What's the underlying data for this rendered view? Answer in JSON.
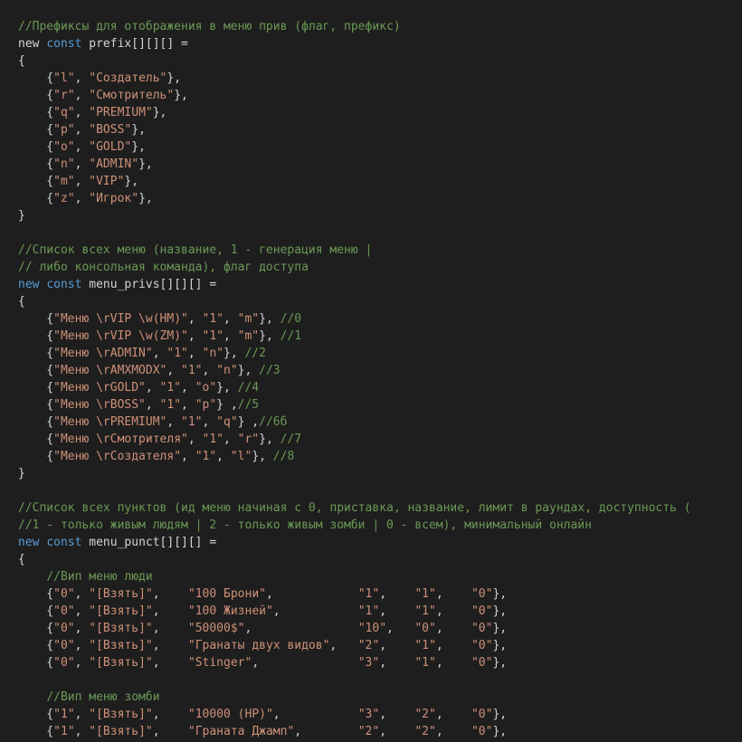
{
  "code": {
    "lines": [
      [
        {
          "t": "comment",
          "v": "//Префиксы для отображения в меню прив (флаг, префикс)"
        }
      ],
      [
        {
          "t": "plain",
          "v": "new "
        },
        {
          "t": "keyword",
          "v": "const"
        },
        {
          "t": "plain",
          "v": " prefix[][][] ="
        }
      ],
      [
        {
          "t": "plain",
          "v": "{"
        }
      ],
      [
        {
          "t": "plain",
          "v": "    {"
        },
        {
          "t": "string",
          "v": "\"l\""
        },
        {
          "t": "plain",
          "v": ", "
        },
        {
          "t": "string",
          "v": "\"Создатель\""
        },
        {
          "t": "plain",
          "v": "},"
        }
      ],
      [
        {
          "t": "plain",
          "v": "    {"
        },
        {
          "t": "string",
          "v": "\"r\""
        },
        {
          "t": "plain",
          "v": ", "
        },
        {
          "t": "string",
          "v": "\"Смотритель\""
        },
        {
          "t": "plain",
          "v": "},"
        }
      ],
      [
        {
          "t": "plain",
          "v": "    {"
        },
        {
          "t": "string",
          "v": "\"q\""
        },
        {
          "t": "plain",
          "v": ", "
        },
        {
          "t": "string",
          "v": "\"PREMIUM\""
        },
        {
          "t": "plain",
          "v": "},"
        }
      ],
      [
        {
          "t": "plain",
          "v": "    {"
        },
        {
          "t": "string",
          "v": "\"p\""
        },
        {
          "t": "plain",
          "v": ", "
        },
        {
          "t": "string",
          "v": "\"BOSS\""
        },
        {
          "t": "plain",
          "v": "},"
        }
      ],
      [
        {
          "t": "plain",
          "v": "    {"
        },
        {
          "t": "string",
          "v": "\"o\""
        },
        {
          "t": "plain",
          "v": ", "
        },
        {
          "t": "string",
          "v": "\"GOLD\""
        },
        {
          "t": "plain",
          "v": "},"
        }
      ],
      [
        {
          "t": "plain",
          "v": "    {"
        },
        {
          "t": "string",
          "v": "\"n\""
        },
        {
          "t": "plain",
          "v": ", "
        },
        {
          "t": "string",
          "v": "\"ADMIN\""
        },
        {
          "t": "plain",
          "v": "},"
        }
      ],
      [
        {
          "t": "plain",
          "v": "    {"
        },
        {
          "t": "string",
          "v": "\"m\""
        },
        {
          "t": "plain",
          "v": ", "
        },
        {
          "t": "string",
          "v": "\"VIP\""
        },
        {
          "t": "plain",
          "v": "},"
        }
      ],
      [
        {
          "t": "plain",
          "v": "    {"
        },
        {
          "t": "string",
          "v": "\"z\""
        },
        {
          "t": "plain",
          "v": ", "
        },
        {
          "t": "string",
          "v": "\"Игрок\""
        },
        {
          "t": "plain",
          "v": "},"
        }
      ],
      [
        {
          "t": "plain",
          "v": "}"
        }
      ],
      [
        {
          "t": "plain",
          "v": ""
        }
      ],
      [
        {
          "t": "comment",
          "v": "//Список всех меню (название, 1 - генерация меню |"
        }
      ],
      [
        {
          "t": "comment",
          "v": "// либо консольная команда), флаг доступа"
        }
      ],
      [
        {
          "t": "keyword",
          "v": "new"
        },
        {
          "t": "plain",
          "v": " "
        },
        {
          "t": "keyword",
          "v": "const"
        },
        {
          "t": "plain",
          "v": " menu_privs[][][] ="
        }
      ],
      [
        {
          "t": "plain",
          "v": "{"
        }
      ],
      [
        {
          "t": "plain",
          "v": "    {"
        },
        {
          "t": "string",
          "v": "\"Меню \\rVIP \\w(HM)\""
        },
        {
          "t": "plain",
          "v": ", "
        },
        {
          "t": "string",
          "v": "\"1\""
        },
        {
          "t": "plain",
          "v": ", "
        },
        {
          "t": "string",
          "v": "\"m\""
        },
        {
          "t": "plain",
          "v": "}, "
        },
        {
          "t": "comment",
          "v": "//0"
        }
      ],
      [
        {
          "t": "plain",
          "v": "    {"
        },
        {
          "t": "string",
          "v": "\"Меню \\rVIP \\w(ZM)\""
        },
        {
          "t": "plain",
          "v": ", "
        },
        {
          "t": "string",
          "v": "\"1\""
        },
        {
          "t": "plain",
          "v": ", "
        },
        {
          "t": "string",
          "v": "\"m\""
        },
        {
          "t": "plain",
          "v": "}, "
        },
        {
          "t": "comment",
          "v": "//1"
        }
      ],
      [
        {
          "t": "plain",
          "v": "    {"
        },
        {
          "t": "string",
          "v": "\"Меню \\rADMIN\""
        },
        {
          "t": "plain",
          "v": ", "
        },
        {
          "t": "string",
          "v": "\"1\""
        },
        {
          "t": "plain",
          "v": ", "
        },
        {
          "t": "string",
          "v": "\"n\""
        },
        {
          "t": "plain",
          "v": "}, "
        },
        {
          "t": "comment",
          "v": "//2"
        }
      ],
      [
        {
          "t": "plain",
          "v": "    {"
        },
        {
          "t": "string",
          "v": "\"Меню \\rAMXMODX\""
        },
        {
          "t": "plain",
          "v": ", "
        },
        {
          "t": "string",
          "v": "\"1\""
        },
        {
          "t": "plain",
          "v": ", "
        },
        {
          "t": "string",
          "v": "\"n\""
        },
        {
          "t": "plain",
          "v": "}, "
        },
        {
          "t": "comment",
          "v": "//3"
        }
      ],
      [
        {
          "t": "plain",
          "v": "    {"
        },
        {
          "t": "string",
          "v": "\"Меню \\rGOLD\""
        },
        {
          "t": "plain",
          "v": ", "
        },
        {
          "t": "string",
          "v": "\"1\""
        },
        {
          "t": "plain",
          "v": ", "
        },
        {
          "t": "string",
          "v": "\"o\""
        },
        {
          "t": "plain",
          "v": "}, "
        },
        {
          "t": "comment",
          "v": "//4"
        }
      ],
      [
        {
          "t": "plain",
          "v": "    {"
        },
        {
          "t": "string",
          "v": "\"Меню \\rBOSS\""
        },
        {
          "t": "plain",
          "v": ", "
        },
        {
          "t": "string",
          "v": "\"1\""
        },
        {
          "t": "plain",
          "v": ", "
        },
        {
          "t": "string",
          "v": "\"p\""
        },
        {
          "t": "plain",
          "v": "} ,"
        },
        {
          "t": "comment",
          "v": "//5"
        }
      ],
      [
        {
          "t": "plain",
          "v": "    {"
        },
        {
          "t": "string",
          "v": "\"Меню \\rPREMIUM\""
        },
        {
          "t": "plain",
          "v": ", "
        },
        {
          "t": "string",
          "v": "\"1\""
        },
        {
          "t": "plain",
          "v": ", "
        },
        {
          "t": "string",
          "v": "\"q\""
        },
        {
          "t": "plain",
          "v": "} ,"
        },
        {
          "t": "comment",
          "v": "//6б"
        }
      ],
      [
        {
          "t": "plain",
          "v": "    {"
        },
        {
          "t": "string",
          "v": "\"Меню \\rСмотрителя\""
        },
        {
          "t": "plain",
          "v": ", "
        },
        {
          "t": "string",
          "v": "\"1\""
        },
        {
          "t": "plain",
          "v": ", "
        },
        {
          "t": "string",
          "v": "\"r\""
        },
        {
          "t": "plain",
          "v": "}, "
        },
        {
          "t": "comment",
          "v": "//7"
        }
      ],
      [
        {
          "t": "plain",
          "v": "    {"
        },
        {
          "t": "string",
          "v": "\"Меню \\rСоздателя\""
        },
        {
          "t": "plain",
          "v": ", "
        },
        {
          "t": "string",
          "v": "\"1\""
        },
        {
          "t": "plain",
          "v": ", "
        },
        {
          "t": "string",
          "v": "\"l\""
        },
        {
          "t": "plain",
          "v": "}, "
        },
        {
          "t": "comment",
          "v": "//8"
        }
      ],
      [
        {
          "t": "plain",
          "v": "}"
        }
      ],
      [
        {
          "t": "plain",
          "v": ""
        }
      ],
      [
        {
          "t": "comment",
          "v": "//Список всех пунктов (ид меню начиная с 0, приставка, название, лимит в раундах, доступность ("
        }
      ],
      [
        {
          "t": "comment",
          "v": "//1 - только живым людям | 2 - только живым зомби | 0 - всем), минимальный онлайн"
        }
      ],
      [
        {
          "t": "keyword",
          "v": "new"
        },
        {
          "t": "plain",
          "v": " "
        },
        {
          "t": "keyword",
          "v": "const"
        },
        {
          "t": "plain",
          "v": " menu_punct[][][] ="
        }
      ],
      [
        {
          "t": "plain",
          "v": "{"
        }
      ],
      [
        {
          "t": "plain",
          "v": "    "
        },
        {
          "t": "comment",
          "v": "//Вип меню люди"
        }
      ],
      [
        {
          "t": "plain",
          "v": "    {"
        },
        {
          "t": "string",
          "v": "\"0\""
        },
        {
          "t": "plain",
          "v": ", "
        },
        {
          "t": "string",
          "v": "\"[Взять]\""
        },
        {
          "t": "plain",
          "v": ",    "
        },
        {
          "t": "string",
          "v": "\"100 Брони\""
        },
        {
          "t": "plain",
          "v": ",            "
        },
        {
          "t": "string",
          "v": "\"1\""
        },
        {
          "t": "plain",
          "v": ",    "
        },
        {
          "t": "string",
          "v": "\"1\""
        },
        {
          "t": "plain",
          "v": ",    "
        },
        {
          "t": "string",
          "v": "\"0\""
        },
        {
          "t": "plain",
          "v": "},"
        }
      ],
      [
        {
          "t": "plain",
          "v": "    {"
        },
        {
          "t": "string",
          "v": "\"0\""
        },
        {
          "t": "plain",
          "v": ", "
        },
        {
          "t": "string",
          "v": "\"[Взять]\""
        },
        {
          "t": "plain",
          "v": ",    "
        },
        {
          "t": "string",
          "v": "\"100 Жизней\""
        },
        {
          "t": "plain",
          "v": ",           "
        },
        {
          "t": "string",
          "v": "\"1\""
        },
        {
          "t": "plain",
          "v": ",    "
        },
        {
          "t": "string",
          "v": "\"1\""
        },
        {
          "t": "plain",
          "v": ",    "
        },
        {
          "t": "string",
          "v": "\"0\""
        },
        {
          "t": "plain",
          "v": "},"
        }
      ],
      [
        {
          "t": "plain",
          "v": "    {"
        },
        {
          "t": "string",
          "v": "\"0\""
        },
        {
          "t": "plain",
          "v": ", "
        },
        {
          "t": "string",
          "v": "\"[Взять]\""
        },
        {
          "t": "plain",
          "v": ",    "
        },
        {
          "t": "string",
          "v": "\"50000$\""
        },
        {
          "t": "plain",
          "v": ",               "
        },
        {
          "t": "string",
          "v": "\"10\""
        },
        {
          "t": "plain",
          "v": ",   "
        },
        {
          "t": "string",
          "v": "\"0\""
        },
        {
          "t": "plain",
          "v": ",    "
        },
        {
          "t": "string",
          "v": "\"0\""
        },
        {
          "t": "plain",
          "v": "},"
        }
      ],
      [
        {
          "t": "plain",
          "v": "    {"
        },
        {
          "t": "string",
          "v": "\"0\""
        },
        {
          "t": "plain",
          "v": ", "
        },
        {
          "t": "string",
          "v": "\"[Взять]\""
        },
        {
          "t": "plain",
          "v": ",    "
        },
        {
          "t": "string",
          "v": "\"Гранаты двух видов\""
        },
        {
          "t": "plain",
          "v": ",   "
        },
        {
          "t": "string",
          "v": "\"2\""
        },
        {
          "t": "plain",
          "v": ",    "
        },
        {
          "t": "string",
          "v": "\"1\""
        },
        {
          "t": "plain",
          "v": ",    "
        },
        {
          "t": "string",
          "v": "\"0\""
        },
        {
          "t": "plain",
          "v": "},"
        }
      ],
      [
        {
          "t": "plain",
          "v": "    {"
        },
        {
          "t": "string",
          "v": "\"0\""
        },
        {
          "t": "plain",
          "v": ", "
        },
        {
          "t": "string",
          "v": "\"[Взять]\""
        },
        {
          "t": "plain",
          "v": ",    "
        },
        {
          "t": "string",
          "v": "\"Stinger\""
        },
        {
          "t": "plain",
          "v": ",              "
        },
        {
          "t": "string",
          "v": "\"3\""
        },
        {
          "t": "plain",
          "v": ",    "
        },
        {
          "t": "string",
          "v": "\"1\""
        },
        {
          "t": "plain",
          "v": ",    "
        },
        {
          "t": "string",
          "v": "\"0\""
        },
        {
          "t": "plain",
          "v": "},"
        }
      ],
      [
        {
          "t": "plain",
          "v": ""
        }
      ],
      [
        {
          "t": "plain",
          "v": "    "
        },
        {
          "t": "comment",
          "v": "//Вип меню зомби"
        }
      ],
      [
        {
          "t": "plain",
          "v": "    {"
        },
        {
          "t": "string",
          "v": "\"1\""
        },
        {
          "t": "plain",
          "v": ", "
        },
        {
          "t": "string",
          "v": "\"[Взять]\""
        },
        {
          "t": "plain",
          "v": ",    "
        },
        {
          "t": "string",
          "v": "\"10000 (HP)\""
        },
        {
          "t": "plain",
          "v": ",           "
        },
        {
          "t": "string",
          "v": "\"3\""
        },
        {
          "t": "plain",
          "v": ",    "
        },
        {
          "t": "string",
          "v": "\"2\""
        },
        {
          "t": "plain",
          "v": ",    "
        },
        {
          "t": "string",
          "v": "\"0\""
        },
        {
          "t": "plain",
          "v": "},"
        }
      ],
      [
        {
          "t": "plain",
          "v": "    {"
        },
        {
          "t": "string",
          "v": "\"1\""
        },
        {
          "t": "plain",
          "v": ", "
        },
        {
          "t": "string",
          "v": "\"[Взять]\""
        },
        {
          "t": "plain",
          "v": ",    "
        },
        {
          "t": "string",
          "v": "\"Граната Джамп\""
        },
        {
          "t": "plain",
          "v": ",        "
        },
        {
          "t": "string",
          "v": "\"2\""
        },
        {
          "t": "plain",
          "v": ",    "
        },
        {
          "t": "string",
          "v": "\"2\""
        },
        {
          "t": "plain",
          "v": ",    "
        },
        {
          "t": "string",
          "v": "\"0\""
        },
        {
          "t": "plain",
          "v": "},"
        }
      ]
    ]
  }
}
